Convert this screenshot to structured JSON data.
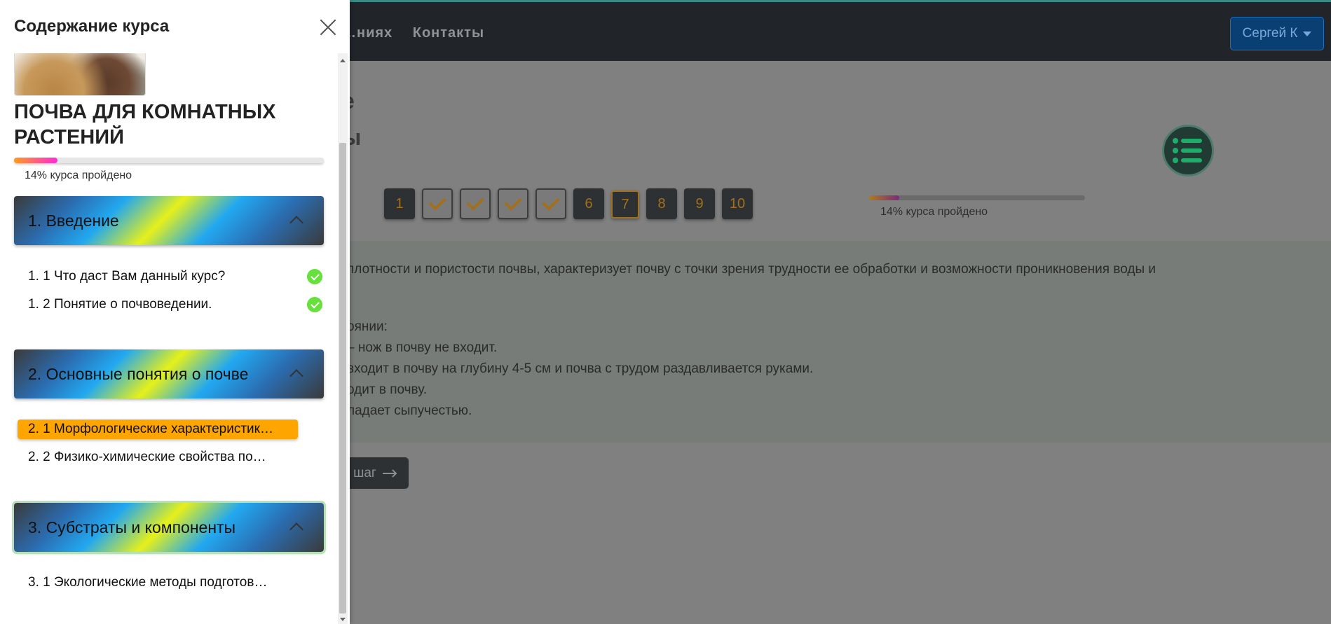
{
  "navbar": {
    "links": [
      "…ниях",
      "Контакты"
    ],
    "user_label": "Сергей К"
  },
  "background": {
    "title_fragments": [
      "е",
      "ы"
    ],
    "steps": [
      {
        "label": "1",
        "state": "normal"
      },
      {
        "label": "",
        "state": "done"
      },
      {
        "label": "",
        "state": "done"
      },
      {
        "label": "",
        "state": "done"
      },
      {
        "label": "",
        "state": "done"
      },
      {
        "label": "6",
        "state": "normal"
      },
      {
        "label": "7",
        "state": "current"
      },
      {
        "label": "8",
        "state": "normal"
      },
      {
        "label": "9",
        "state": "normal"
      },
      {
        "label": "10",
        "state": "normal"
      }
    ],
    "progress_percent": 14,
    "progress_text": "14% курса пройдено",
    "content_lines": [
      "плотности и пористости почвы, характеризует почву с точки зрения трудности ее обработки и возможности проникновения воды и",
      "оянии:",
      "– нож в почву не входит.",
      "входит в почву на глубину 4-5 см и почва с трудом раздавливается руками.",
      "одит в почву.",
      "ладает сыпучестью."
    ],
    "next_button_label": "шаг"
  },
  "sidebar": {
    "title": "Содержание курса",
    "course_title": "ПОЧВА ДЛЯ КОМНАТНЫХ РАСТЕНИЙ",
    "progress_percent": 14,
    "progress_text": "14% курса пройдено",
    "sections": [
      {
        "label": "1. Введение",
        "lessons": [
          {
            "label": "1. 1 Что даст Вам данный курс?",
            "completed": true
          },
          {
            "label": "1. 2 Понятие о почвоведении.",
            "completed": true
          }
        ]
      },
      {
        "label": "2. Основные понятия о почве",
        "lessons": [
          {
            "label": "2. 1 Морфологические характеристик…",
            "current": true
          },
          {
            "label": "2. 2 Физико-химические свойства по…"
          }
        ]
      },
      {
        "label": "3. Субстраты и компоненты",
        "lessons": [
          {
            "label": "3. 1 Экологические методы подготов…"
          }
        ]
      }
    ]
  },
  "colors": {
    "accent_orange": "#ffa500",
    "check_green": "#66e03a",
    "navbar_dark": "#212529",
    "user_button": "#0a3f73"
  }
}
